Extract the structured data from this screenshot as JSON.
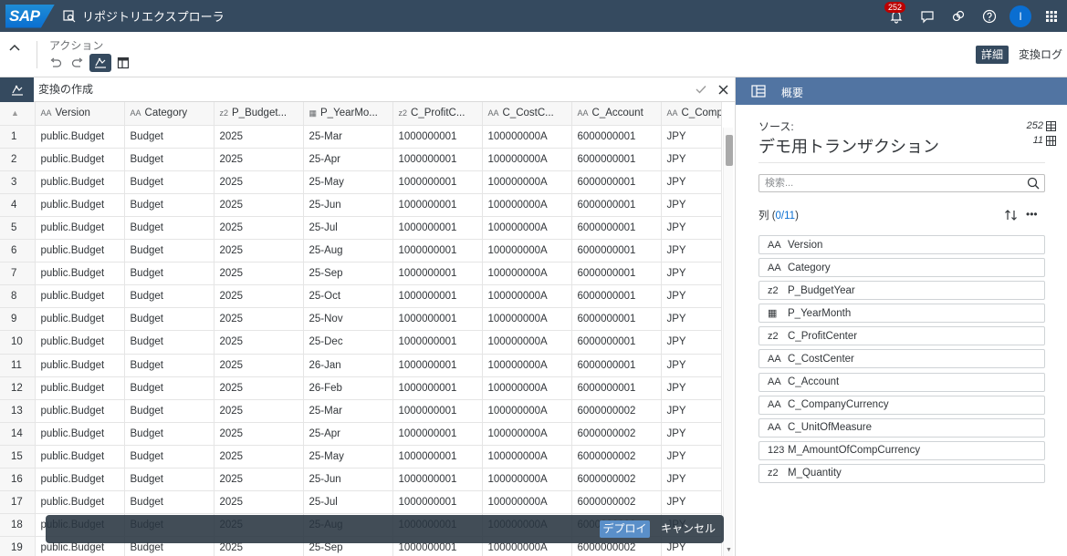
{
  "shell": {
    "logo": "SAP",
    "title": "リポジトリエクスプローラ",
    "notification_count": "252",
    "avatar_initial": "I"
  },
  "actions": {
    "label": "アクション",
    "detail_label": "詳細",
    "log_label": "変換ログ"
  },
  "transformation": {
    "placeholder": "変換の作成"
  },
  "table": {
    "columns": [
      {
        "type": "AA",
        "label": "Version"
      },
      {
        "type": "AA",
        "label": "Category"
      },
      {
        "type": "z2",
        "label": "P_Budget..."
      },
      {
        "type": "cal",
        "label": "P_YearMo..."
      },
      {
        "type": "z2",
        "label": "C_ProfitC..."
      },
      {
        "type": "AA",
        "label": "C_CostC..."
      },
      {
        "type": "AA",
        "label": "C_Account"
      },
      {
        "type": "AA",
        "label": "C_Compa..."
      }
    ],
    "rows": [
      [
        "1",
        "public.Budget",
        "Budget",
        "2025",
        "25-Mar",
        "1000000001",
        "100000000A",
        "6000000001",
        "JPY"
      ],
      [
        "2",
        "public.Budget",
        "Budget",
        "2025",
        "25-Apr",
        "1000000001",
        "100000000A",
        "6000000001",
        "JPY"
      ],
      [
        "3",
        "public.Budget",
        "Budget",
        "2025",
        "25-May",
        "1000000001",
        "100000000A",
        "6000000001",
        "JPY"
      ],
      [
        "4",
        "public.Budget",
        "Budget",
        "2025",
        "25-Jun",
        "1000000001",
        "100000000A",
        "6000000001",
        "JPY"
      ],
      [
        "5",
        "public.Budget",
        "Budget",
        "2025",
        "25-Jul",
        "1000000001",
        "100000000A",
        "6000000001",
        "JPY"
      ],
      [
        "6",
        "public.Budget",
        "Budget",
        "2025",
        "25-Aug",
        "1000000001",
        "100000000A",
        "6000000001",
        "JPY"
      ],
      [
        "7",
        "public.Budget",
        "Budget",
        "2025",
        "25-Sep",
        "1000000001",
        "100000000A",
        "6000000001",
        "JPY"
      ],
      [
        "8",
        "public.Budget",
        "Budget",
        "2025",
        "25-Oct",
        "1000000001",
        "100000000A",
        "6000000001",
        "JPY"
      ],
      [
        "9",
        "public.Budget",
        "Budget",
        "2025",
        "25-Nov",
        "1000000001",
        "100000000A",
        "6000000001",
        "JPY"
      ],
      [
        "10",
        "public.Budget",
        "Budget",
        "2025",
        "25-Dec",
        "1000000001",
        "100000000A",
        "6000000001",
        "JPY"
      ],
      [
        "11",
        "public.Budget",
        "Budget",
        "2025",
        "26-Jan",
        "1000000001",
        "100000000A",
        "6000000001",
        "JPY"
      ],
      [
        "12",
        "public.Budget",
        "Budget",
        "2025",
        "26-Feb",
        "1000000001",
        "100000000A",
        "6000000001",
        "JPY"
      ],
      [
        "13",
        "public.Budget",
        "Budget",
        "2025",
        "25-Mar",
        "1000000001",
        "100000000A",
        "6000000002",
        "JPY"
      ],
      [
        "14",
        "public.Budget",
        "Budget",
        "2025",
        "25-Apr",
        "1000000001",
        "100000000A",
        "6000000002",
        "JPY"
      ],
      [
        "15",
        "public.Budget",
        "Budget",
        "2025",
        "25-May",
        "1000000001",
        "100000000A",
        "6000000002",
        "JPY"
      ],
      [
        "16",
        "public.Budget",
        "Budget",
        "2025",
        "25-Jun",
        "1000000001",
        "100000000A",
        "6000000002",
        "JPY"
      ],
      [
        "17",
        "public.Budget",
        "Budget",
        "2025",
        "25-Jul",
        "1000000001",
        "100000000A",
        "6000000002",
        "JPY"
      ],
      [
        "18",
        "public.Budget",
        "Budget",
        "2025",
        "25-Aug",
        "1000000001",
        "100000000A",
        "6000000002",
        "JPY"
      ],
      [
        "19",
        "public.Budget",
        "Budget",
        "2025",
        "25-Sep",
        "1000000001",
        "100000000A",
        "6000000002",
        "JPY"
      ]
    ]
  },
  "deploy_bar": {
    "deploy_label": "デプロイ",
    "cancel_label": "キャンセル"
  },
  "panel": {
    "header_title": "概要",
    "source_label": "ソース:",
    "source_name": "デモ用トランザクション",
    "row_count": "252",
    "column_count": "11",
    "search_placeholder": "検索...",
    "columns_label_prefix": "列 (",
    "columns_count": "0/11",
    "columns_label_suffix": ")",
    "columns": [
      {
        "icon": "AA",
        "label": "Version"
      },
      {
        "icon": "AA",
        "label": "Category"
      },
      {
        "icon": "z2",
        "label": "P_BudgetYear"
      },
      {
        "icon": "cal",
        "label": "P_YearMonth"
      },
      {
        "icon": "z2",
        "label": "C_ProfitCenter"
      },
      {
        "icon": "AA",
        "label": "C_CostCenter"
      },
      {
        "icon": "AA",
        "label": "C_Account"
      },
      {
        "icon": "AA",
        "label": "C_CompanyCurrency"
      },
      {
        "icon": "AA",
        "label": "C_UnitOfMeasure"
      },
      {
        "icon": "123",
        "label": "M_AmountOfCompCurrency"
      },
      {
        "icon": "z2",
        "label": "M_Quantity"
      }
    ]
  }
}
